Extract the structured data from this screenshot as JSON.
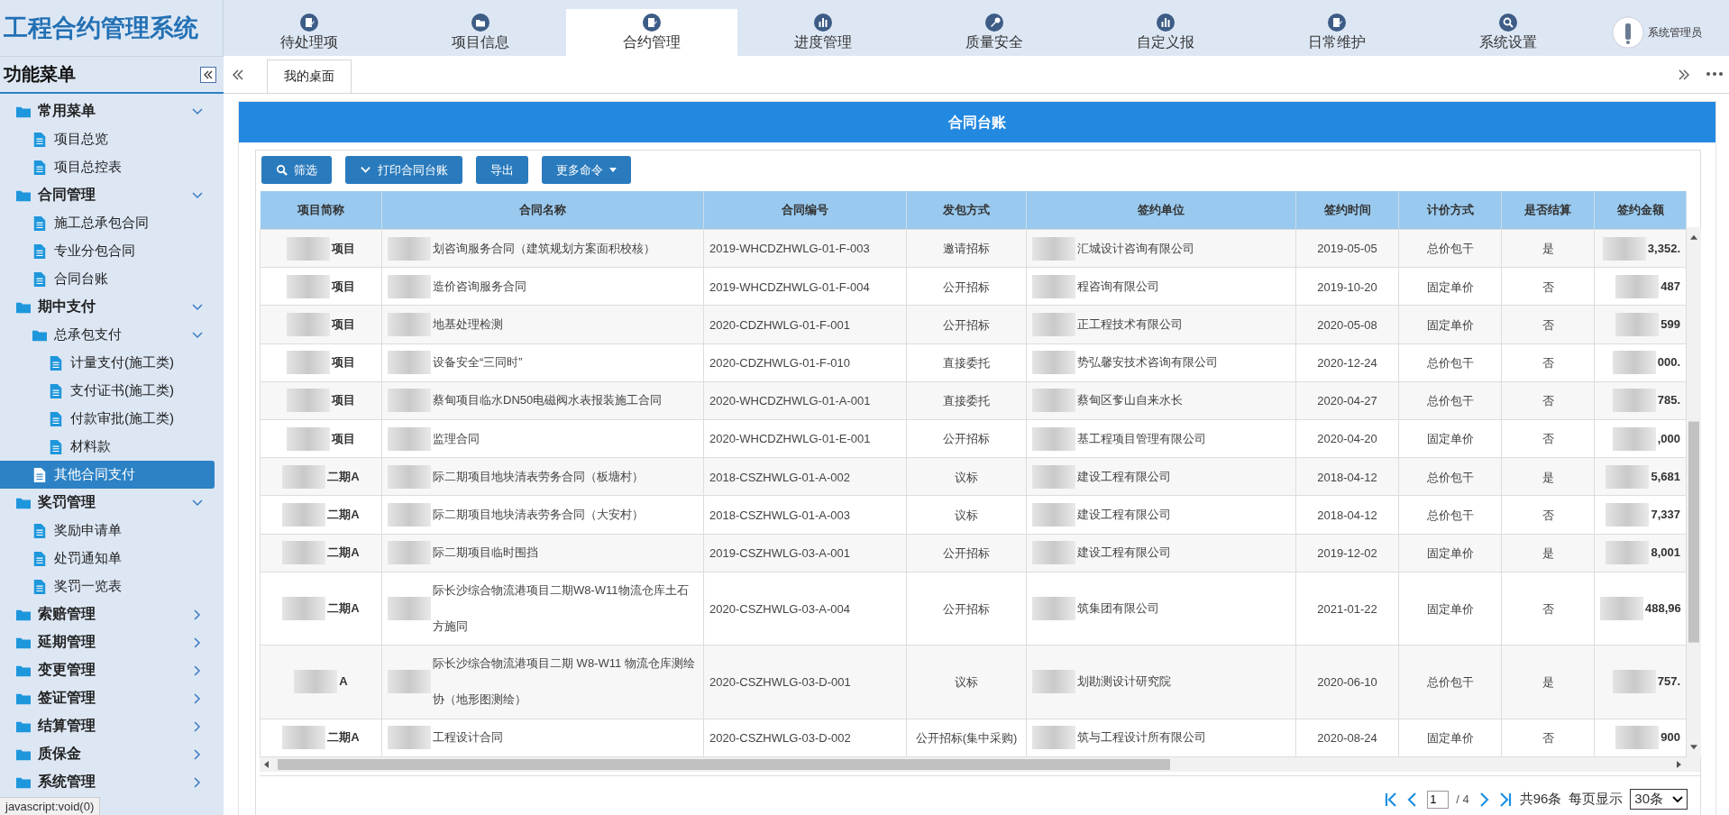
{
  "app_title": "工程合约管理系统",
  "nav_tabs": [
    {
      "label": "待处理项",
      "selected": false
    },
    {
      "label": "项目信息",
      "selected": false
    },
    {
      "label": "合约管理",
      "selected": true
    },
    {
      "label": "进度管理",
      "selected": false
    },
    {
      "label": "质量安全",
      "selected": false
    },
    {
      "label": "自定义报",
      "selected": false
    },
    {
      "label": "日常维护",
      "selected": false
    },
    {
      "label": "系统设置",
      "selected": false
    }
  ],
  "user": {
    "name": "系统管理员"
  },
  "sidebar": {
    "title": "功能菜单",
    "items": [
      {
        "label": "常用菜单",
        "kind": "folder",
        "expanded": true,
        "selected": false,
        "children": [
          {
            "label": "项目总览",
            "kind": "page",
            "selected": false
          },
          {
            "label": "项目总控表",
            "kind": "page",
            "selected": false
          }
        ]
      },
      {
        "label": "合同管理",
        "kind": "folder",
        "expanded": true,
        "selected": false,
        "children": [
          {
            "label": "施工总承包合同",
            "kind": "page",
            "selected": false
          },
          {
            "label": "专业分包合同",
            "kind": "page",
            "selected": false
          },
          {
            "label": "合同台账",
            "kind": "page",
            "selected": false
          }
        ]
      },
      {
        "label": "期中支付",
        "kind": "folder",
        "expanded": true,
        "selected": false,
        "children": [
          {
            "label": "总承包支付",
            "kind": "folder",
            "expanded": true,
            "selected": false,
            "children": [
              {
                "label": "计量支付(施工类)",
                "kind": "page",
                "selected": false
              },
              {
                "label": "支付证书(施工类)",
                "kind": "page",
                "selected": false
              },
              {
                "label": "付款审批(施工类)",
                "kind": "page",
                "selected": false
              },
              {
                "label": "材料款",
                "kind": "page",
                "selected": false
              }
            ]
          },
          {
            "label": "其他合同支付",
            "kind": "page",
            "selected": true
          }
        ]
      },
      {
        "label": "奖罚管理",
        "kind": "folder",
        "expanded": true,
        "selected": false,
        "children": [
          {
            "label": "奖励申请单",
            "kind": "page",
            "selected": false
          },
          {
            "label": "处罚通知单",
            "kind": "page",
            "selected": false
          },
          {
            "label": "奖罚一览表",
            "kind": "page",
            "selected": false
          }
        ]
      },
      {
        "label": "索赔管理",
        "kind": "folder",
        "expanded": false,
        "selected": false
      },
      {
        "label": "延期管理",
        "kind": "folder",
        "expanded": false,
        "selected": false
      },
      {
        "label": "变更管理",
        "kind": "folder",
        "expanded": false,
        "selected": false
      },
      {
        "label": "签证管理",
        "kind": "folder",
        "expanded": false,
        "selected": false
      },
      {
        "label": "结算管理",
        "kind": "folder",
        "expanded": false,
        "selected": false
      },
      {
        "label": "质保金",
        "kind": "folder",
        "expanded": false,
        "selected": false
      },
      {
        "label": "系统管理",
        "kind": "folder",
        "expanded": false,
        "selected": false
      }
    ]
  },
  "page_tabs": [
    {
      "label": "我的桌面",
      "selected": true
    }
  ],
  "panel": {
    "title": "合同台账",
    "toolbar": [
      {
        "label": "筛选",
        "kind": "search"
      },
      {
        "label": "打印合同台账",
        "kind": "chevron"
      },
      {
        "label": "导出",
        "kind": "plain"
      },
      {
        "label": "更多命令",
        "kind": "dropdown"
      }
    ],
    "table": {
      "columns": [
        "项目简称",
        "合同名称",
        "合同编号",
        "发包方式",
        "签约单位",
        "签约时间",
        "计价方式",
        "是否结算",
        "签约金额"
      ],
      "rows": [
        [
          "项目",
          "划咨询服务合同（建筑规划方案面积校核）",
          "2019-WHCDZHWLG-01-F-003",
          "邀请招标",
          "汇城设计咨询有限公司",
          "2019-05-05",
          "总价包干",
          "是",
          "3,352."
        ],
        [
          "项目",
          "造价咨询服务合同",
          "2019-WHCDZHWLG-01-F-004",
          "公开招标",
          "程咨询有限公司",
          "2019-10-20",
          "固定单价",
          "否",
          "487"
        ],
        [
          "项目",
          "地基处理检测",
          "2020-CDZHWLG-01-F-001",
          "公开招标",
          "正工程技术有限公司",
          "2020-05-08",
          "固定单价",
          "否",
          "599"
        ],
        [
          "项目",
          "设备安全“三同时”",
          "2020-CDZHWLG-01-F-010",
          "直接委托",
          "势弘馨安技术咨询有限公司",
          "2020-12-24",
          "总价包干",
          "否",
          "000."
        ],
        [
          "项目",
          "蔡甸项目临水DN50电磁阀水表报装施工合同",
          "2020-WHCDZHWLG-01-A-001",
          "直接委托",
          "蔡甸区奓山自来水长",
          "2020-04-27",
          "总价包干",
          "否",
          "785."
        ],
        [
          "项目",
          "监理合同",
          "2020-WHCDZHWLG-01-E-001",
          "公开招标",
          "基工程项目管理有限公司",
          "2020-04-20",
          "固定单价",
          "否",
          ",000"
        ],
        [
          "二期A",
          "际二期项目地块清表劳务合同（板塘村）",
          "2018-CSZHWLG-01-A-002",
          "议标",
          "建设工程有限公司",
          "2018-04-12",
          "总价包干",
          "是",
          "5,681"
        ],
        [
          "二期A",
          "际二期项目地块清表劳务合同（大安村）",
          "2018-CSZHWLG-01-A-003",
          "议标",
          "建设工程有限公司",
          "2018-04-12",
          "总价包干",
          "否",
          "7,337"
        ],
        [
          "二期A",
          "际二期项目临时围挡",
          "2019-CSZHWLG-03-A-001",
          "公开招标",
          "建设工程有限公司",
          "2019-12-02",
          "固定单价",
          "是",
          "8,001"
        ],
        [
          "二期A",
          "际长沙综合物流港项目二期W8-W11物流仓库土石方施同",
          "2020-CSZHWLG-03-A-004",
          "公开招标",
          "筑集团有限公司",
          "2021-01-22",
          "固定单价",
          "否",
          "488,96"
        ],
        [
          "A",
          "际长沙综合物流港项目二期 W8-W11 物流仓库测绘协（地形图测绘）",
          "2020-CSZHWLG-03-D-001",
          "议标",
          "划勘测设计研究院",
          "2020-06-10",
          "总价包干",
          "是",
          "757."
        ],
        [
          "二期A",
          "工程设计合同",
          "2020-CSZHWLG-03-D-002",
          "公开招标(集中采购)",
          "筑与工程设计所有限公司",
          "2020-08-24",
          "固定单价",
          "否",
          "900"
        ]
      ]
    },
    "pager": {
      "page": "1",
      "pages": "/ 4",
      "total": "共96条",
      "per_page_label": "每页显示",
      "per_page": "30条"
    }
  },
  "status": "javascript:void(0)"
}
